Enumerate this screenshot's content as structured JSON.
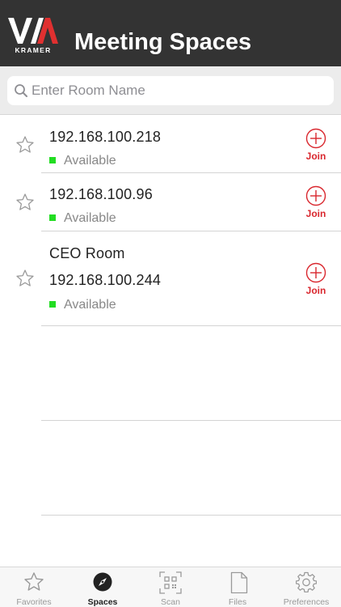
{
  "header": {
    "logo_text": "V/A",
    "logo_subtext": "KRAMER",
    "title": "Meeting Spaces"
  },
  "search": {
    "placeholder": "Enter Room Name",
    "value": ""
  },
  "rooms": [
    {
      "name": "",
      "ip": "192.168.100.218",
      "status": "Available",
      "join_label": "Join"
    },
    {
      "name": "",
      "ip": "192.168.100.96",
      "status": "Available",
      "join_label": "Join"
    },
    {
      "name": "CEO Room",
      "ip": "192.168.100.244",
      "status": "Available",
      "join_label": "Join"
    }
  ],
  "tabs": [
    {
      "label": "Favorites",
      "icon": "star-icon",
      "active": false
    },
    {
      "label": "Spaces",
      "icon": "compass-icon",
      "active": true
    },
    {
      "label": "Scan",
      "icon": "qr-code-icon",
      "active": false
    },
    {
      "label": "Files",
      "icon": "file-icon",
      "active": false
    },
    {
      "label": "Preferences",
      "icon": "gear-icon",
      "active": false
    }
  ],
  "colors": {
    "header_bg": "#333333",
    "join_red": "#d9272e",
    "available_green": "#22dd22"
  }
}
